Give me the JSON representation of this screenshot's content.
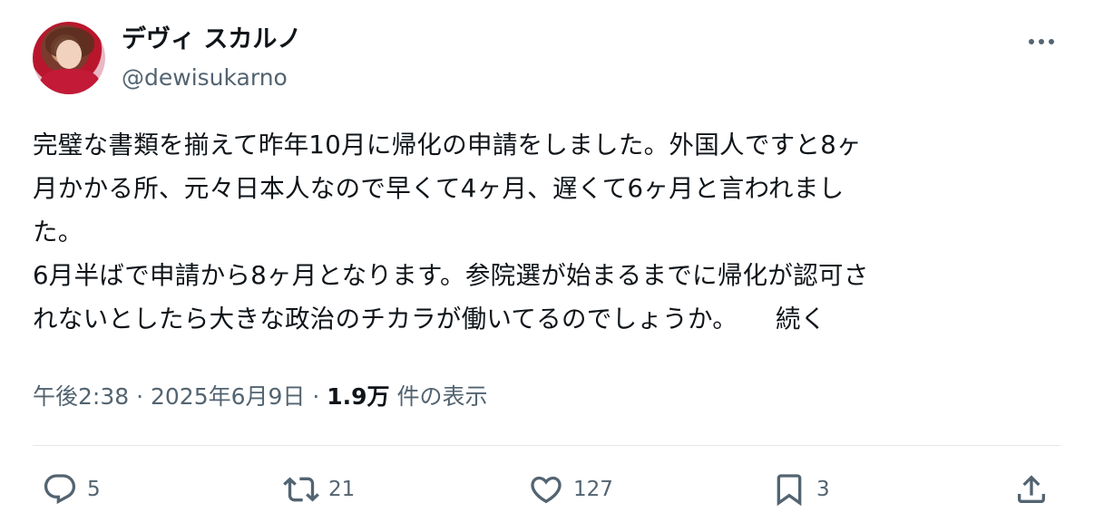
{
  "author": {
    "display_name": "デヴィ スカルノ",
    "handle": "@dewisukarno"
  },
  "tweet": {
    "text": "完璧な書類を揃えて昨年10月に帰化の申請をしました。外国人ですと8ヶ\n月かかる所、元々日本人なので早くて4ヶ月、遅くて6ヶ月と言われまし\nた。\n6月半ばで申請から8ヶ月となります。参院選が始まるまでに帰化が認可さ\nれないとしたら大きな政治のチカラが働いてるのでしょうか。　　続く"
  },
  "meta": {
    "time": "午後2:38",
    "sep1": " · ",
    "date": "2025年6月9日",
    "sep2": " · ",
    "views_count": "1.9万",
    "views_label": " 件の表示"
  },
  "actions": {
    "reply_count": "5",
    "retweet_count": "21",
    "like_count": "127",
    "bookmark_count": "3"
  },
  "icons": {
    "reply": "speech-bubble-icon",
    "retweet": "retweet-arrows-icon",
    "like": "heart-icon",
    "bookmark": "bookmark-icon",
    "share": "share-upload-icon",
    "more": "more-horizontal-icon"
  },
  "colors": {
    "text_primary": "#0f1419",
    "text_secondary": "#536471",
    "divider": "#e3e7ea"
  }
}
